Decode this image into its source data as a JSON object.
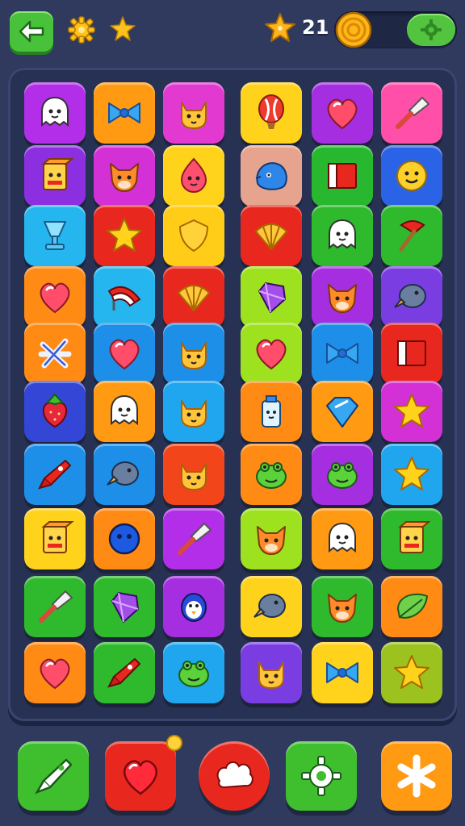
{
  "header": {
    "back_icon": "back-arrow-icon",
    "settings_icon": "gear-icon",
    "bonus_icon": "star-icon",
    "star_count": "21",
    "coin_icon": "coin-icon",
    "add_icon": "gear-icon"
  },
  "colors": {
    "background": "#2f3a5e",
    "board": "#273153",
    "green": "#3fbf2e",
    "red": "#e8281e",
    "orange": "#ff8a14",
    "yellow": "#ffd21c",
    "purple": "#a42ee0",
    "magenta": "#e23ad0",
    "blue": "#1e8fe8",
    "cyan": "#25b6ef",
    "lime": "#9ee21f",
    "pink": "#ff4fa8"
  },
  "board": {
    "rows": [
      [
        {
          "icon": "ghost",
          "color": "#b22ee8"
        },
        {
          "icon": "bow",
          "color": "#ff9a12"
        },
        {
          "icon": "cat",
          "color": "#e23ad0"
        },
        {
          "icon": "balloon",
          "color": "#ffd21c"
        },
        {
          "icon": "heart",
          "color": "#a42ee0"
        },
        {
          "icon": "shovel",
          "color": "#ff4fa8"
        }
      ],
      [
        {
          "icon": "box",
          "color": "#8b2fe0"
        },
        {
          "icon": "fox",
          "color": "#d330d6"
        },
        {
          "icon": "drop-face",
          "color": "#ffd21c"
        },
        {
          "icon": "blob",
          "color": "#e6a48e"
        },
        {
          "icon": "flag",
          "color": "#27b82f"
        },
        {
          "icon": "smiley",
          "color": "#2b63e6"
        }
      ],
      [
        {
          "icon": "cup",
          "color": "#25b6ef"
        },
        {
          "icon": "star",
          "color": "#e8281e"
        },
        {
          "icon": "shield",
          "color": "#ffcd18"
        },
        {
          "icon": "shell",
          "color": "#e8281e"
        },
        {
          "icon": "ghost",
          "color": "#2fb92c"
        },
        {
          "icon": "axe",
          "color": "#2fb92c"
        }
      ],
      [
        {
          "icon": "heart",
          "color": "#ff8a14"
        },
        {
          "icon": "fan",
          "color": "#25b6ef"
        },
        {
          "icon": "shell",
          "color": "#e8281e"
        },
        {
          "icon": "gem",
          "color": "#9ee21f"
        },
        {
          "icon": "fox",
          "color": "#a42ee0"
        },
        {
          "icon": "bird",
          "color": "#7a3de2"
        }
      ],
      [
        {
          "icon": "knot",
          "color": "#ff8a14"
        },
        {
          "icon": "heart",
          "color": "#1e8fe8"
        },
        {
          "icon": "cat",
          "color": "#1e8fe8"
        },
        {
          "icon": "heart",
          "color": "#9ee21f"
        },
        {
          "icon": "bow",
          "color": "#1e8fe8"
        },
        {
          "icon": "flag",
          "color": "#e8281e"
        }
      ],
      [
        {
          "icon": "strawberry",
          "color": "#3346d6"
        },
        {
          "icon": "ghost",
          "color": "#ff9a12"
        },
        {
          "icon": "cat",
          "color": "#1fa6ee"
        },
        {
          "icon": "bottle",
          "color": "#ff8a14"
        },
        {
          "icon": "diamond",
          "color": "#ff9a12"
        },
        {
          "icon": "star",
          "color": "#d330d6"
        }
      ],
      [
        {
          "icon": "rocket",
          "color": "#1e8fe8"
        },
        {
          "icon": "bird",
          "color": "#1e8fe8"
        },
        {
          "icon": "cat",
          "color": "#f2461a"
        },
        {
          "icon": "frog",
          "color": "#ff8a14"
        },
        {
          "icon": "frog",
          "color": "#a42ee0"
        },
        {
          "icon": "star",
          "color": "#1fa6ee"
        }
      ],
      [
        {
          "icon": "box",
          "color": "#ffd21c"
        },
        {
          "icon": "ball",
          "color": "#ff8a14"
        },
        {
          "icon": "shovel",
          "color": "#b22ee8"
        },
        {
          "icon": "fox",
          "color": "#9ee21f"
        },
        {
          "icon": "ghost",
          "color": "#ff9a12"
        },
        {
          "icon": "box",
          "color": "#2fb92c"
        }
      ],
      [
        {
          "icon": "shovel",
          "color": "#2fb92c"
        },
        {
          "icon": "gem",
          "color": "#2fb92c"
        },
        {
          "icon": "penguin",
          "color": "#a42ee0"
        },
        {
          "icon": "bird",
          "color": "#ffd21c"
        },
        {
          "icon": "fox",
          "color": "#2fb92c"
        },
        {
          "icon": "leaf",
          "color": "#ff8a14"
        }
      ],
      [
        {
          "icon": "heart",
          "color": "#ff8a14"
        },
        {
          "icon": "rocket",
          "color": "#2fb92c"
        },
        {
          "icon": "frog",
          "color": "#1fa6ee"
        },
        {
          "icon": "cat",
          "color": "#7a3de2"
        },
        {
          "icon": "bow",
          "color": "#ffd21c"
        },
        {
          "icon": "star",
          "color": "#9cc21f"
        }
      ]
    ]
  },
  "toolbar": {
    "buttons": [
      {
        "name": "hammer-booster-button",
        "icon": "rocket-icon",
        "color": "#3fbf2e"
      },
      {
        "name": "heart-booster-button",
        "icon": "heart-icon",
        "color": "#e8281e",
        "has_notification": true
      },
      {
        "name": "cloud-booster-button",
        "icon": "cloud-icon",
        "color": "#e8281e"
      },
      {
        "name": "settings-button",
        "icon": "gear-icon",
        "color": "#3fbf2e"
      },
      {
        "name": "sparkle-booster-button",
        "icon": "asterisk-icon",
        "color": "#ff9a12"
      }
    ]
  }
}
